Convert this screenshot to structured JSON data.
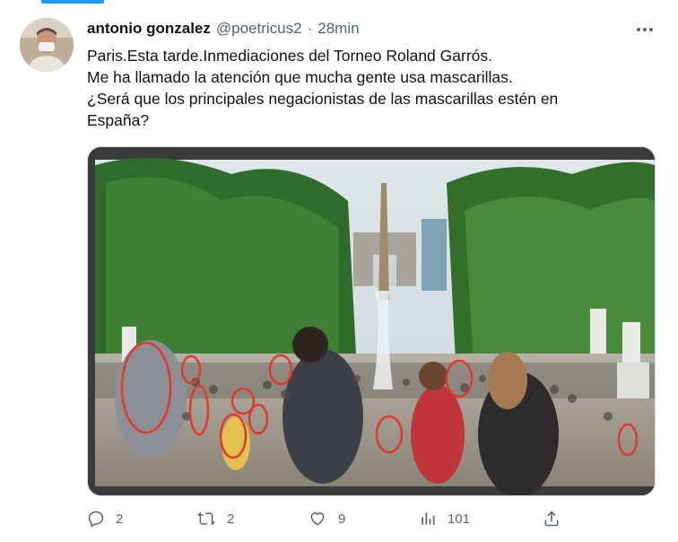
{
  "tweet": {
    "author_name": "antonio gonzalez",
    "author_handle": "@poetricus2",
    "separator": "·",
    "time_ago": "28min",
    "text_lines": [
      "Paris.Esta tarde.Inmediaciones del Torneo Roland Garrós.",
      "Me ha llamado la atención que mucha gente usa mascarillas.",
      "¿Será que los principales negacionistas de las mascarillas estén en",
      "España?"
    ],
    "media": {
      "description_icon": "photo-of-crowd-at-tuileries-garden"
    },
    "actions": {
      "replies": "2",
      "retweets": "2",
      "likes": "9",
      "views": "101"
    }
  },
  "icons": {
    "more": "more-options-icon",
    "reply": "reply-icon",
    "retweet": "retweet-icon",
    "like": "heart-icon",
    "views": "views-chart-icon",
    "share": "share-icon"
  },
  "colors": {
    "accent": "#1d9bf0",
    "secondary_text": "#536471",
    "primary_text": "#0f1419"
  }
}
